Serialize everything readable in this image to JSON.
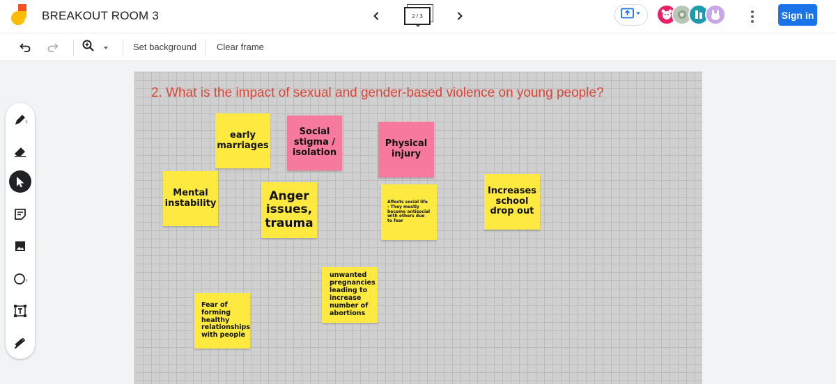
{
  "header": {
    "title": "BREAKOUT ROOM 3",
    "frame_indicator": "2 / 3",
    "signin_label": "Sign in"
  },
  "toolbar": {
    "set_background_label": "Set background",
    "clear_frame_label": "Clear frame"
  },
  "icons": {
    "logo": "jamboard-logo",
    "prev": "chevron-left-icon",
    "next": "chevron-right-icon",
    "present": "cast-present-icon",
    "more": "more-vert-icon",
    "undo": "undo-icon",
    "redo": "redo-icon",
    "zoom": "zoom-icon",
    "pen": "pen-icon",
    "eraser": "eraser-icon",
    "select": "select-arrow-icon",
    "sticky": "sticky-note-icon",
    "image": "image-icon",
    "circle": "circle-shape-icon",
    "textbox": "text-box-icon",
    "laser": "laser-pointer-icon"
  },
  "colors": {
    "question": "#db4437",
    "note_yellow": "#fde93f",
    "note_pink": "#f7799d",
    "signin": "#1a73e8"
  },
  "canvas": {
    "question": "2. What is the impact of sexual and gender-based violence on young people?",
    "notes": [
      {
        "text": "early marriages",
        "color": "yellow"
      },
      {
        "text": "Social stigma / isolation",
        "color": "pink"
      },
      {
        "text": "Physical injury",
        "color": "pink"
      },
      {
        "text": "Mental instability",
        "color": "yellow"
      },
      {
        "text": "Anger issues, trauma",
        "color": "yellow"
      },
      {
        "text": "Affects social life - They mostly become antisocial with others due to fear",
        "color": "yellow"
      },
      {
        "text": "Increases school drop out",
        "color": "yellow"
      },
      {
        "text": "unwanted pregnancies leading to increase number of abortions",
        "color": "yellow"
      },
      {
        "text": "Fear of forming healthy relationships with people",
        "color": "yellow"
      }
    ]
  }
}
